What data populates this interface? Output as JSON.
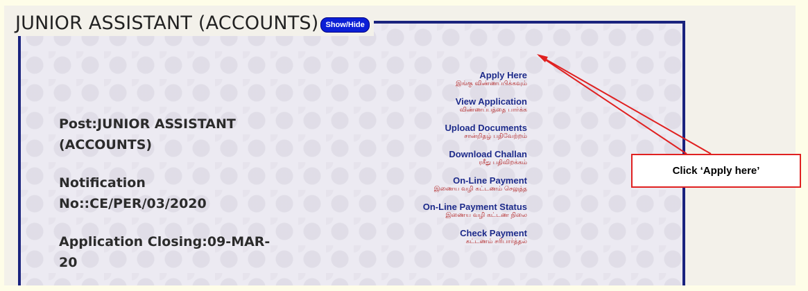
{
  "panel": {
    "title": "JUNIOR ASSISTANT (ACCOUNTS)",
    "show_hide_label": "Show/Hide"
  },
  "post_info": {
    "post": "Post:JUNIOR ASSISTANT (ACCOUNTS)",
    "notification": "Notification No::CE/PER/03/2020",
    "closing": "Application Closing:09-MAR-20"
  },
  "links": [
    {
      "en": "Apply Here",
      "ta": "இங்கு விண்ணப்பிக்கவும்"
    },
    {
      "en": "View Application",
      "ta": "விண்ணப்பத்தை பார்க்க"
    },
    {
      "en": "Upload Documents",
      "ta": "சான்றிதழ் பதிவேற்றம்"
    },
    {
      "en": "Download Challan",
      "ta": "ரசீது பதிவிறக்கம்"
    },
    {
      "en": "On-Line Payment",
      "ta": "இணைய வழி கட்டணம் செலுத்த"
    },
    {
      "en": "On-Line Payment Status",
      "ta": "இணைய வழி கட்டண நிலை"
    },
    {
      "en": "Check Payment",
      "ta": "கட்டணம் சரிபார்த்தல்"
    }
  ],
  "annotation": {
    "callout_text": "Click ‘Apply here’",
    "color": "#e02020"
  }
}
